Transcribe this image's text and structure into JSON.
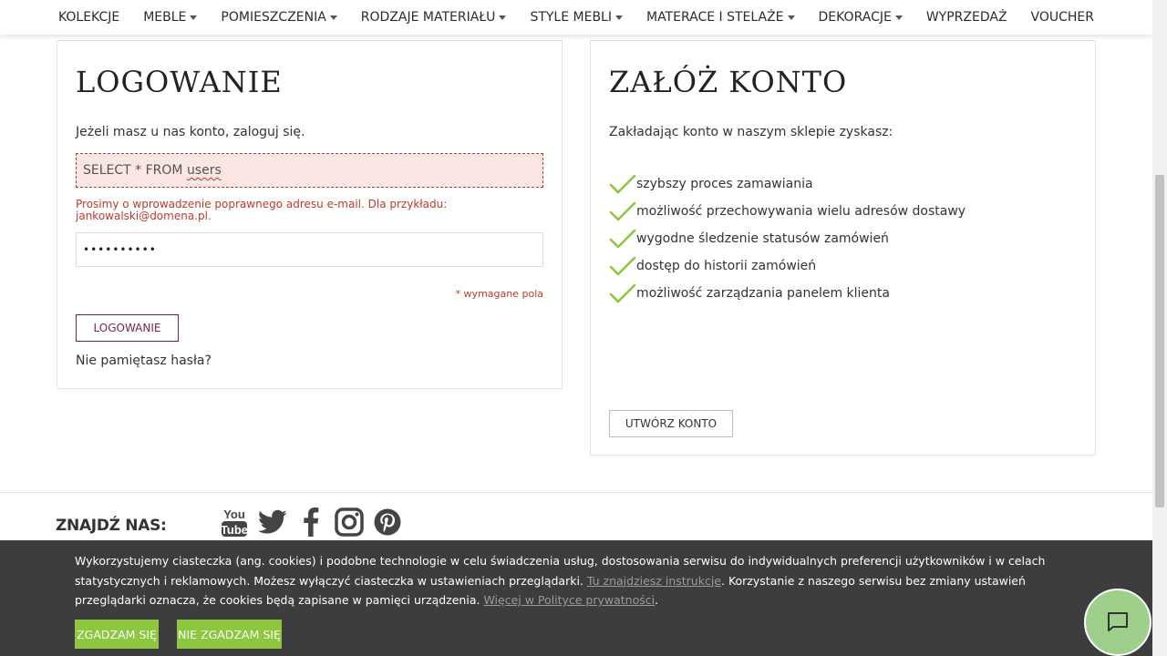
{
  "nav": {
    "items": [
      {
        "label": "KOLEKCJE",
        "dropdown": false
      },
      {
        "label": "MEBLE",
        "dropdown": true
      },
      {
        "label": "POMIESZCZENIA",
        "dropdown": true
      },
      {
        "label": "RODZAJE MATERIAŁU",
        "dropdown": true
      },
      {
        "label": "STYLE MEBLI",
        "dropdown": true
      },
      {
        "label": "MATERACE I STELAŻE",
        "dropdown": true
      },
      {
        "label": "DEKORACJE",
        "dropdown": true
      },
      {
        "label": "WYPRZEDAŻ",
        "dropdown": false
      },
      {
        "label": "VOUCHER",
        "dropdown": false
      }
    ]
  },
  "login": {
    "title": "LOGOWANIE",
    "intro": "Jeżeli masz u nas konto, zaloguj się.",
    "email_value_prefix": "SELECT * FROM ",
    "email_value_word": "users",
    "error": "Prosimy o wprowadzenie poprawnego adresu e-mail. Dla przykładu: jankowalski@domena.pl.",
    "password_value": "••••••••••",
    "required_note": "* wymagane pola",
    "button": "LOGOWANIE",
    "forgot": "Nie pamiętasz hasła?"
  },
  "register": {
    "title": "ZAŁÓŻ KONTO",
    "intro": "Zakładając konto w naszym sklepie zyskasz:",
    "benefits": [
      "szybszy proces zamawiania",
      "możliwość przechowywania wielu adresów dostawy",
      "wygodne śledzenie statusów zamówień",
      "dostęp do historii zamówień",
      "możliwość zarządzania panelem klienta"
    ],
    "button": "UTWÓRZ KONTO"
  },
  "footer": {
    "find_us": "ZNAJDŹ NAS:",
    "socials": [
      "youtube-icon",
      "twitter-icon",
      "facebook-icon",
      "instagram-icon",
      "pinterest-icon"
    ]
  },
  "cookie": {
    "text_1": "Wykorzystujemy ciasteczka (ang. cookies) i podobne technologie w celu świadczenia usług, dostosowania serwisu do indywidualnych preferencji użytkowników i w celach statystycznych i reklamowych. Możesz wyłączyć ciasteczka w ustawieniach przeglądarki. ",
    "link_1": "Tu znajdziesz instrukcje",
    "text_2": ". Korzystanie z naszego serwisu bez zmiany ustawień przeglądarki oznacza, że cookies będą zapisane w pamięci urządzenia. ",
    "link_2": "Więcej w Polityce prywatności",
    "text_3": ".",
    "agree": "ZGADZAM SIĘ",
    "disagree": "NIE ZGADZAM SIĘ"
  },
  "colors": {
    "accent_green": "#8dc63f",
    "error_red": "#c0392b",
    "login_button": "#7a1f4e",
    "cookie_bg": "#3d3d3d",
    "chat_bg": "#9ed08c"
  }
}
